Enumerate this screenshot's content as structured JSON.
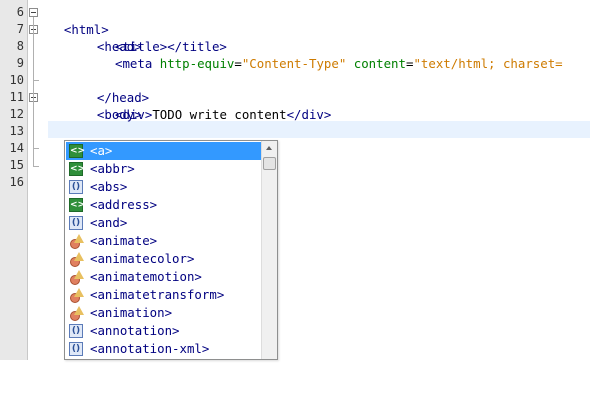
{
  "editor": {
    "line_numbers": [
      "6",
      "7",
      "8",
      "9",
      "10",
      "11",
      "12",
      "13",
      "14",
      "15",
      "16"
    ],
    "lines": {
      "l6_tag": "<html>",
      "l7_tag": "<head>",
      "l8_open": "<title>",
      "l8_close": "</title>",
      "l9_tag": "<meta ",
      "l9_attr1": "http-equiv",
      "l9_eq1": "=",
      "l9_val1": "\"Content-Type\"",
      "l9_sp": " ",
      "l9_attr2": "content",
      "l9_eq2": "=",
      "l9_val2": "\"text/html; charset=",
      "l10_tag": "</head>",
      "l11_tag": "<body>",
      "l12_open": "<div>",
      "l12_text": "TODO write content",
      "l12_close": "</div>",
      "l13_typed": "<",
      "l15_partial": "</"
    }
  },
  "completion": {
    "items": [
      {
        "label": "<a>",
        "icon": "html-tag-icon",
        "selected": true
      },
      {
        "label": "<abbr>",
        "icon": "html-tag-icon"
      },
      {
        "label": "<abs>",
        "icon": "mathml-tag-icon"
      },
      {
        "label": "<address>",
        "icon": "html-tag-icon"
      },
      {
        "label": "<and>",
        "icon": "mathml-tag-icon"
      },
      {
        "label": "<animate>",
        "icon": "svg-tag-icon"
      },
      {
        "label": "<animatecolor>",
        "icon": "svg-tag-icon"
      },
      {
        "label": "<animatemotion>",
        "icon": "svg-tag-icon"
      },
      {
        "label": "<animatetransform>",
        "icon": "svg-tag-icon"
      },
      {
        "label": "<animation>",
        "icon": "svg-tag-icon"
      },
      {
        "label": "<annotation>",
        "icon": "mathml-tag-icon"
      },
      {
        "label": "<annotation-xml>",
        "icon": "mathml-tag-icon"
      }
    ]
  },
  "colors": {
    "tag": "#000080",
    "attribute": "#008000",
    "string": "#ce7b00",
    "selection": "#3399ff",
    "current_line": "#e8f2fe"
  }
}
